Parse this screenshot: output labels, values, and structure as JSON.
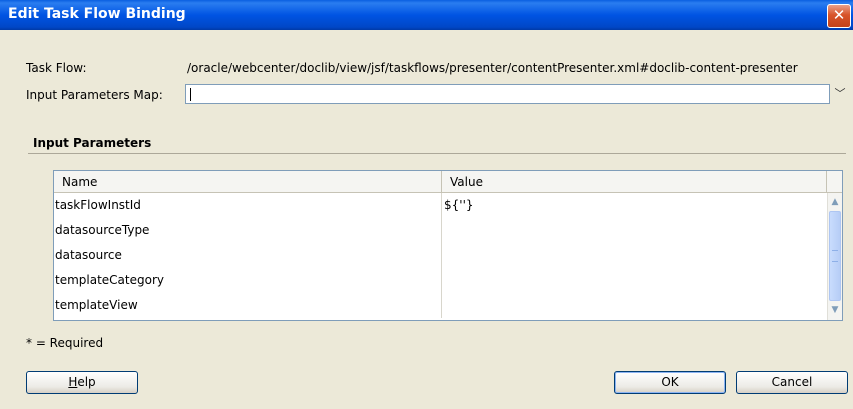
{
  "window": {
    "title": "Edit Task Flow Binding",
    "close_glyph": "✕"
  },
  "form": {
    "task_flow_label": "Task Flow:",
    "task_flow_value": "/oracle/webcenter/doclib/view/jsf/taskflows/presenter/contentPresenter.xml#doclib-content-presenter",
    "input_map_label": "Input Parameters Map:",
    "input_map_value": "",
    "combo_arrow": "﹀"
  },
  "input_parameters": {
    "section_title": "Input Parameters",
    "columns": [
      "Name",
      "Value"
    ],
    "rows": [
      {
        "name": "taskFlowInstId",
        "value": "${''}"
      },
      {
        "name": "datasourceType",
        "value": ""
      },
      {
        "name": "datasource",
        "value": ""
      },
      {
        "name": "templateCategory",
        "value": ""
      },
      {
        "name": "templateView",
        "value": ""
      }
    ],
    "scroll_up": "▲",
    "scroll_down": "▼"
  },
  "footer": {
    "required_note": "* = Required",
    "help_mnemonic": "H",
    "help_rest": "elp",
    "ok_label": "OK",
    "cancel_label": "Cancel"
  }
}
